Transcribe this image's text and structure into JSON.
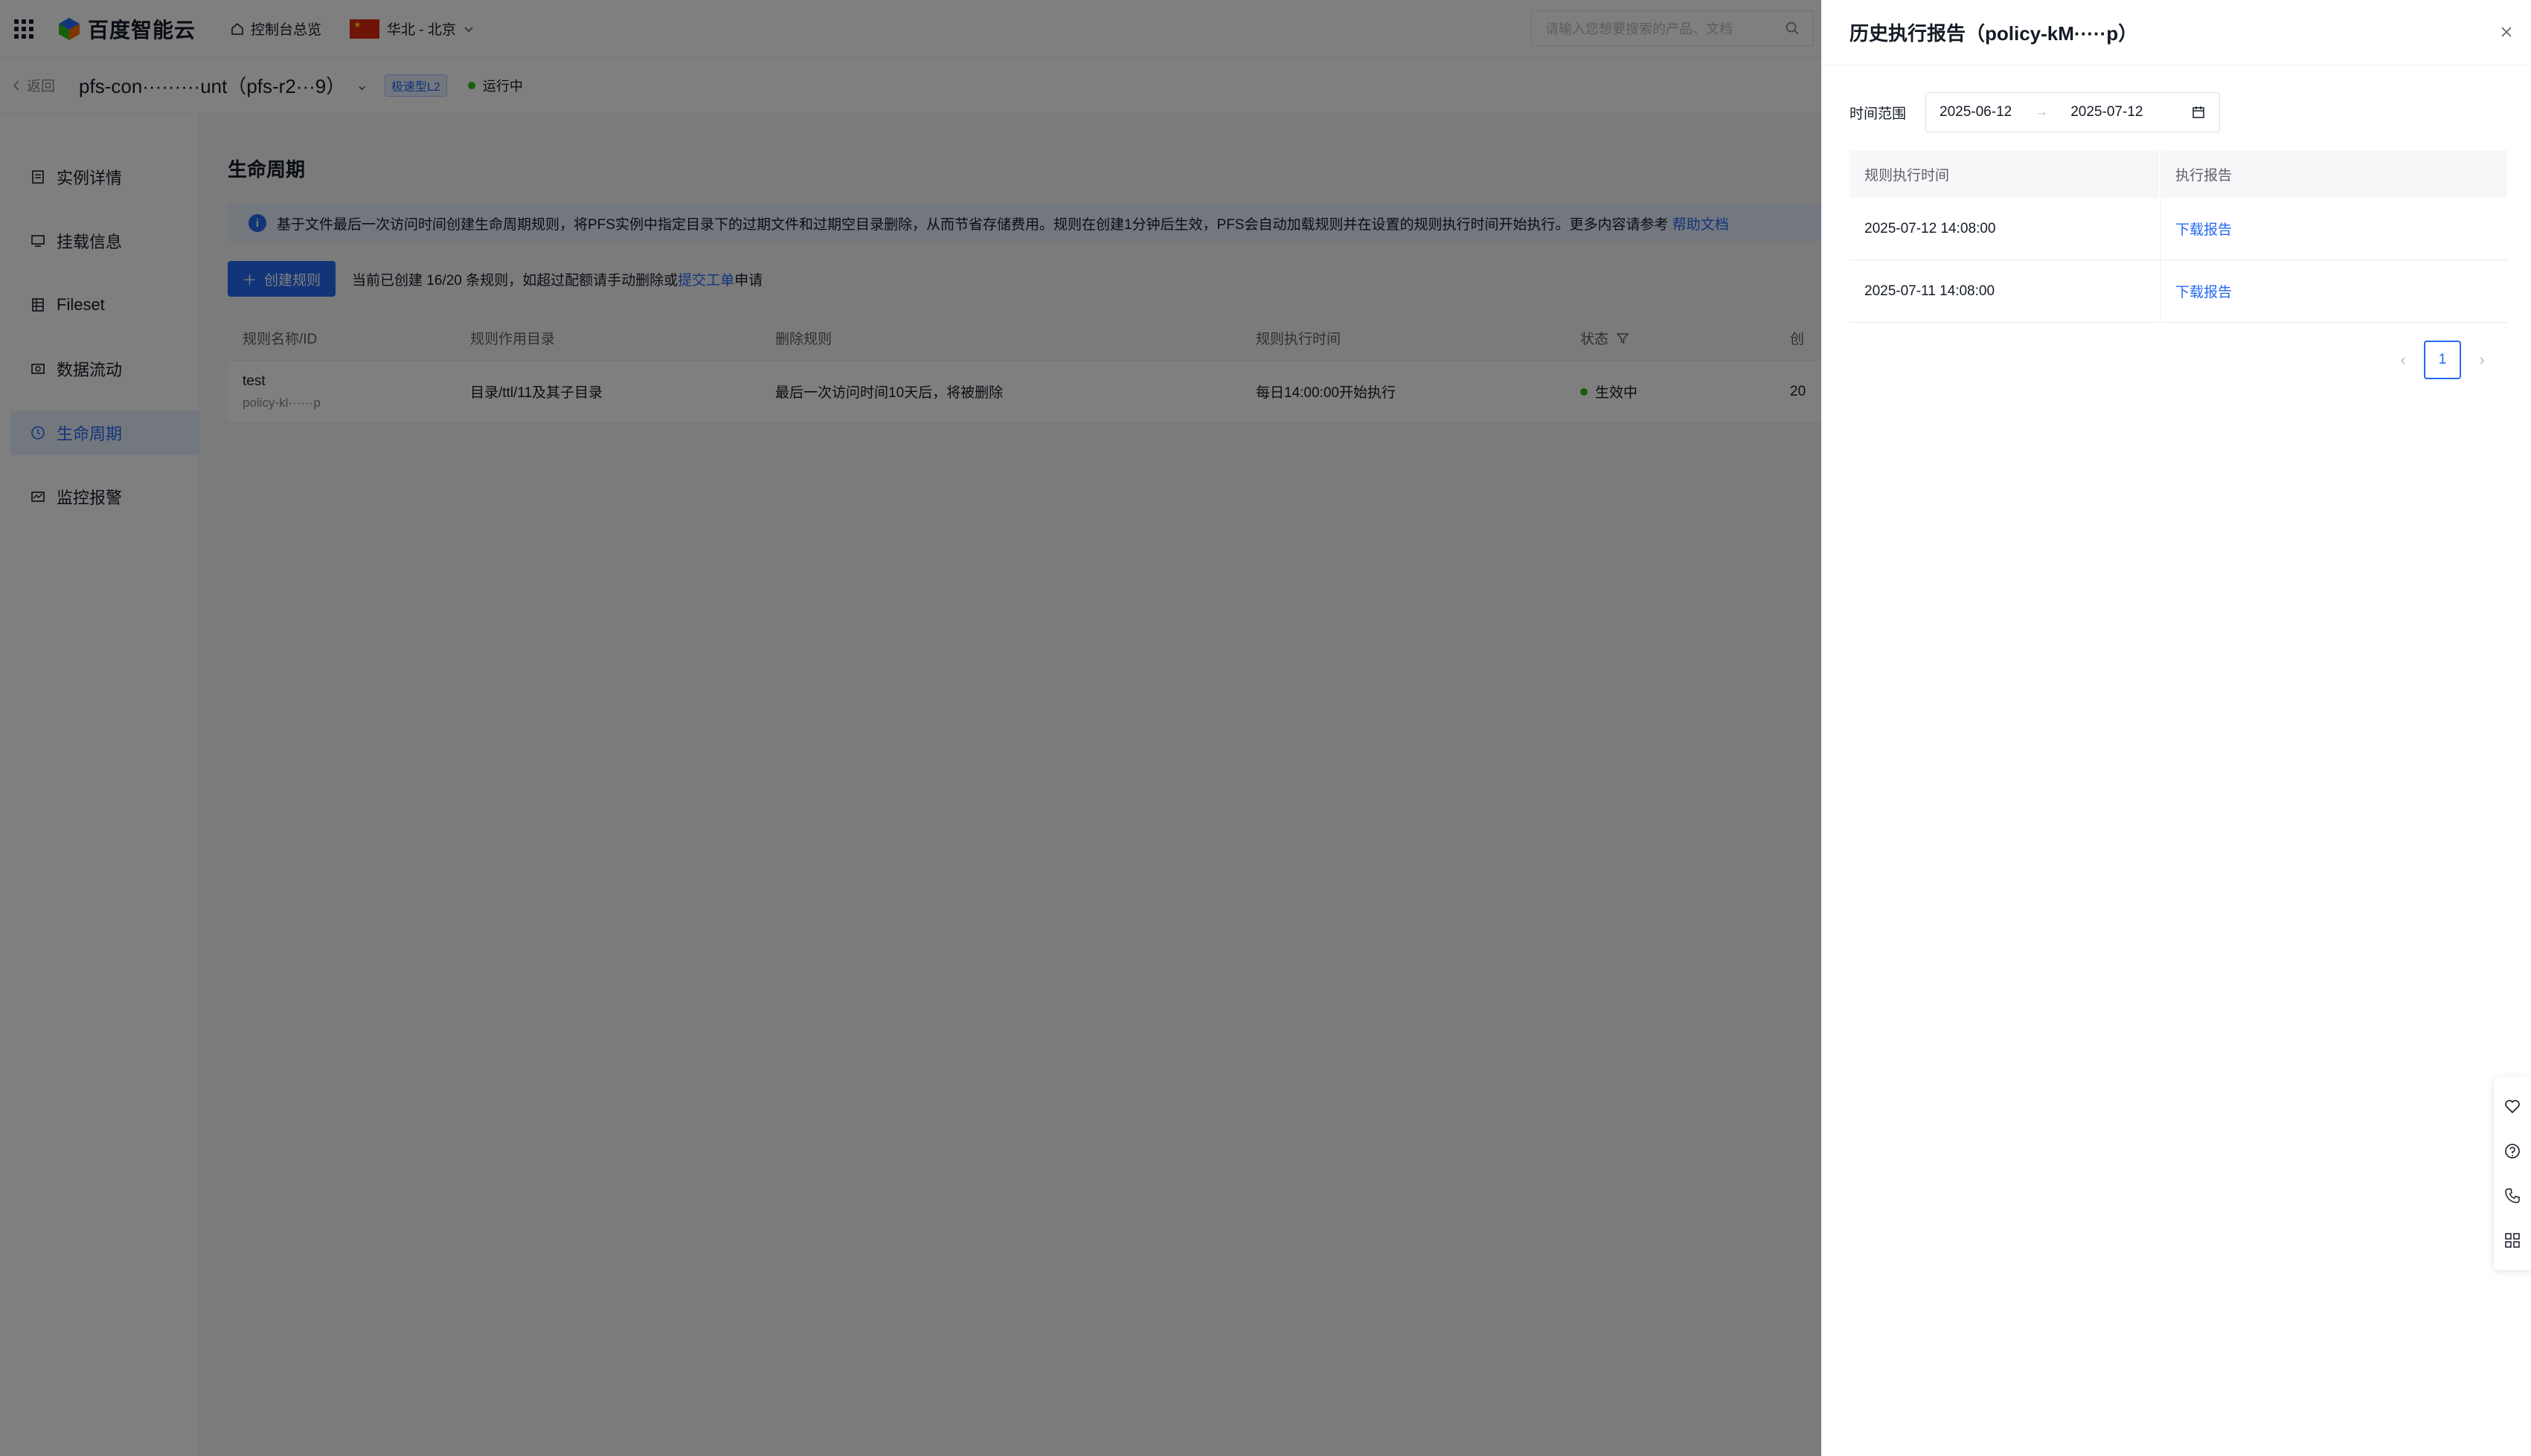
{
  "topbar": {
    "logo_text": "百度智能云",
    "home_label": "控制台总览",
    "region_label": "华北 - 北京",
    "search_placeholder": "请输入您想要搜索的产品、文档"
  },
  "header": {
    "back_label": "返回",
    "instance_name": "pfs-con·········unt（pfs-r2···9）",
    "type_badge": "极速型L2",
    "status": "运行中"
  },
  "sidebar": {
    "items": [
      {
        "label": "实例详情",
        "icon": "list-icon"
      },
      {
        "label": "挂载信息",
        "icon": "monitor-icon"
      },
      {
        "label": "Fileset",
        "icon": "table-icon"
      },
      {
        "label": "数据流动",
        "icon": "flow-icon"
      },
      {
        "label": "生命周期",
        "icon": "clock-icon"
      },
      {
        "label": "监控报警",
        "icon": "alarm-icon"
      }
    ],
    "active_index": 4
  },
  "main": {
    "title": "生命周期",
    "info_text": "基于文件最后一次访问时间创建生命周期规则，将PFS实例中指定目录下的过期文件和过期空目录删除，从而节省存储费用。规则在创建1分钟后生效，PFS会自动加载规则并在设置的规则执行时间开始执行。更多内容请参考",
    "info_link": "帮助文档",
    "create_button": "创建规则",
    "quota_prefix": "当前已创建 16/20 条规则，如超过配额请手动删除或",
    "quota_link": "提交工单",
    "quota_suffix": "申请",
    "table": {
      "columns": [
        "规则名称/ID",
        "规则作用目录",
        "删除规则",
        "规则执行时间",
        "状态",
        "创"
      ],
      "rows": [
        {
          "name": "test",
          "id": "policy-kl······p",
          "dir": "目录/ttl/11及其子目录",
          "rule": "最后一次访问时间10天后，将被删除",
          "exec_time": "每日14:00:00开始执行",
          "status": "生效中",
          "created": "20"
        }
      ]
    }
  },
  "drawer": {
    "title": "历史执行报告（policy-kM·····p）",
    "range_label": "时间范围",
    "start_date": "2025-06-12",
    "range_separator": "→",
    "end_date": "2025-07-12",
    "columns": [
      "规则执行时间",
      "执行报告"
    ],
    "rows": [
      {
        "time": "2025-07-12 14:08:00",
        "action": "下载报告"
      },
      {
        "time": "2025-07-11 14:08:00",
        "action": "下载报告"
      }
    ],
    "current_page": "1"
  },
  "colors": {
    "primary": "#2468f2",
    "success": "#30bf13",
    "mask": "rgba(0,0,0,0.5)"
  }
}
